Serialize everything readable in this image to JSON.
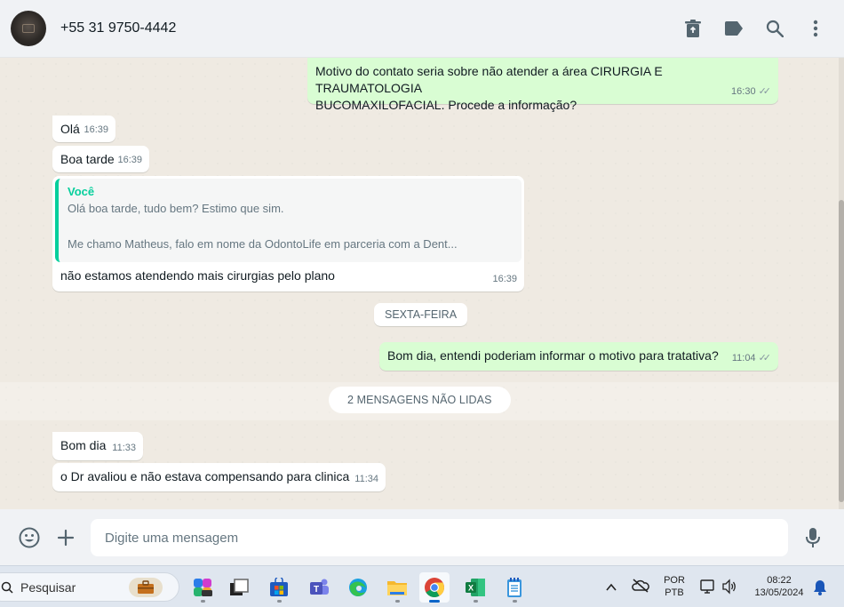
{
  "header": {
    "contact_name": "+55 31 9750-4442",
    "actions": [
      "delete-icon",
      "label-icon",
      "search-icon",
      "menu-icon"
    ]
  },
  "messages": [
    {
      "direction": "out",
      "text": "Motivo do contato seria sobre não atender a área CIRURGIA E TRAUMATOLOGIA\nBUCOMAXILOFACIAL. Procede a informação?",
      "time": "16:30",
      "status": "read"
    },
    {
      "direction": "in",
      "text": "Olá",
      "time": "16:39"
    },
    {
      "direction": "in",
      "text": "Boa tarde",
      "time": "16:39"
    },
    {
      "direction": "in",
      "quote": {
        "author": "Você",
        "text": "Olá boa tarde, tudo bem? Estimo que sim.\n\nMe chamo Matheus, falo em nome da OdontoLife em parceria com a Dent..."
      },
      "text": "não estamos atendendo mais cirurgias pelo plano",
      "time": "16:39"
    },
    {
      "direction": "out",
      "text": "Bom dia, entendi poderiam informar o motivo para tratativa?",
      "time": "11:04",
      "status": "read"
    },
    {
      "direction": "in",
      "text": "Bom dia",
      "time": "11:33"
    },
    {
      "direction": "in",
      "text": "o Dr avaliou e não estava compensando para clinica",
      "time": "11:34"
    }
  ],
  "day_separator": "SEXTA-FEIRA",
  "unread_banner": "2 MENSAGENS NÃO LIDAS",
  "composer": {
    "placeholder": "Digite uma mensagem",
    "left_icons": [
      "emoji-icon",
      "plus-icon"
    ],
    "right_icon": "microphone-icon"
  },
  "taskbar": {
    "search_label": "Pesquisar",
    "apps": [
      "briefcase-icon",
      "copilot-icon",
      "task-view-icon",
      "store-icon",
      "teams-icon",
      "edge-icon",
      "file-explorer-icon",
      "chrome-icon",
      "excel-icon",
      "notepad-icon"
    ],
    "active_app": "chrome-icon",
    "language": "POR",
    "keyboard": "PTB",
    "clock_time": "08:22",
    "clock_date": "13/05/2024"
  },
  "colors": {
    "outgoing_bubble": "#d9fdd3",
    "incoming_bubble": "#ffffff",
    "quote_accent": "#06cf9c",
    "chat_background": "#efeae2",
    "header_background": "#f0f2f5"
  }
}
